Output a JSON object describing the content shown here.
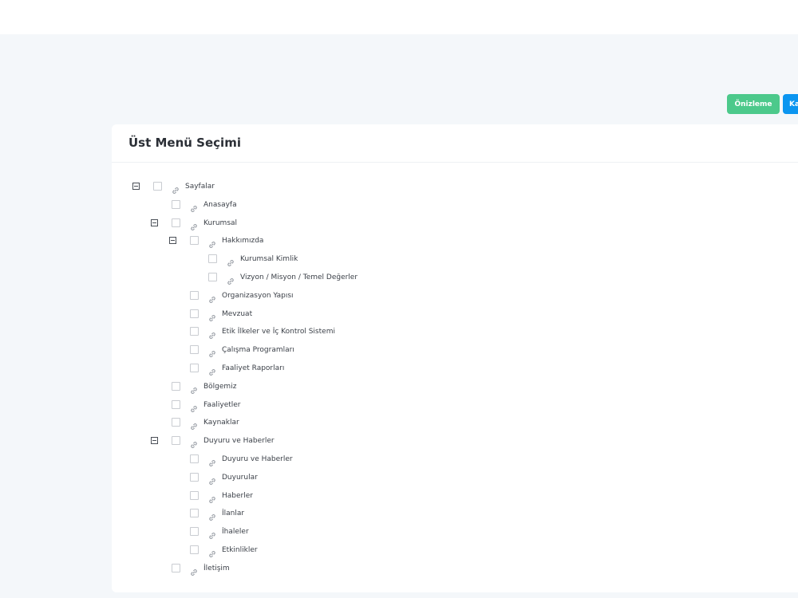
{
  "toolbar": {
    "preview_label": "Önizleme",
    "save_label": "Ka"
  },
  "panel": {
    "title": "Üst Menü Seçimi"
  },
  "tree": [
    {
      "label": "Sayfalar",
      "level": 0,
      "expanded": true
    },
    {
      "label": "Anasayfa",
      "level": 1,
      "expanded": false
    },
    {
      "label": "Kurumsal",
      "level": 1,
      "expanded": true
    },
    {
      "label": "Hakkımızda",
      "level": 2,
      "expanded": true
    },
    {
      "label": "Kurumsal Kimlik",
      "level": 3,
      "expanded": false
    },
    {
      "label": "Vizyon / Misyon / Temel Değerler",
      "level": 3,
      "expanded": false
    },
    {
      "label": "Organizasyon Yapısı",
      "level": 2,
      "expanded": false
    },
    {
      "label": "Mevzuat",
      "level": 2,
      "expanded": false
    },
    {
      "label": "Etik İlkeler ve İç Kontrol Sistemi",
      "level": 2,
      "expanded": false
    },
    {
      "label": "Çalışma Programları",
      "level": 2,
      "expanded": false
    },
    {
      "label": "Faaliyet Raporları",
      "level": 2,
      "expanded": false
    },
    {
      "label": "Bölgemiz",
      "level": 1,
      "expanded": false
    },
    {
      "label": "Faaliyetler",
      "level": 1,
      "expanded": false
    },
    {
      "label": "Kaynaklar",
      "level": 1,
      "expanded": false
    },
    {
      "label": "Duyuru ve Haberler",
      "level": 1,
      "expanded": true
    },
    {
      "label": "Duyuru ve Haberler",
      "level": 2,
      "expanded": false
    },
    {
      "label": "Duyurular",
      "level": 2,
      "expanded": false
    },
    {
      "label": "Haberler",
      "level": 2,
      "expanded": false
    },
    {
      "label": "İlanlar",
      "level": 2,
      "expanded": false
    },
    {
      "label": "İhaleler",
      "level": 2,
      "expanded": false
    },
    {
      "label": "Etkinlikler",
      "level": 2,
      "expanded": false
    },
    {
      "label": "İletişim",
      "level": 1,
      "expanded": false
    }
  ]
}
